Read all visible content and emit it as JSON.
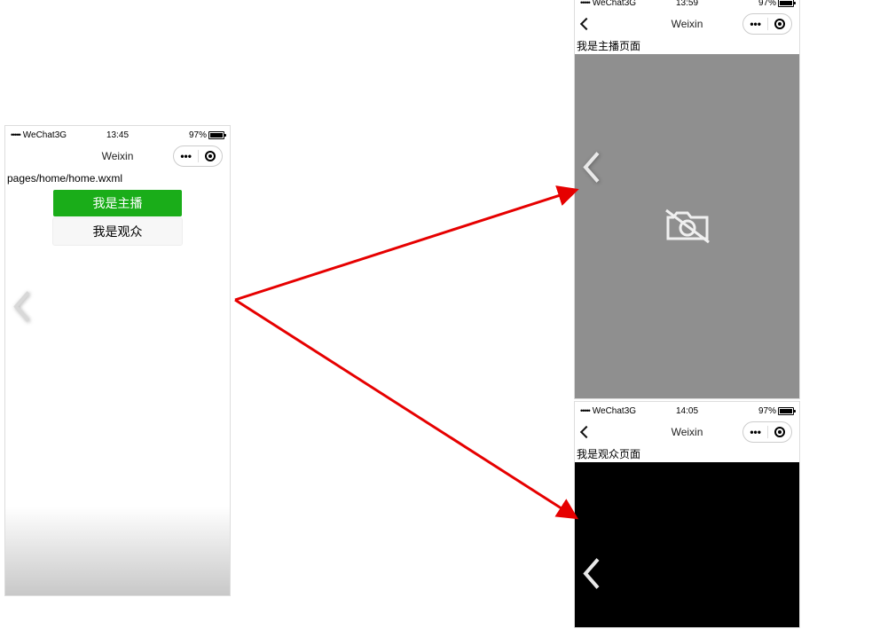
{
  "left": {
    "status": {
      "carrier": "WeChat3G",
      "time": "13:45",
      "battery": "97%"
    },
    "title": "Weixin",
    "path": "pages/home/home.wxml",
    "btn_host": "我是主播",
    "btn_viewer": "我是观众"
  },
  "right_top": {
    "status": {
      "carrier": "WeChat3G",
      "time": "13:59",
      "battery": "97%"
    },
    "title": "Weixin",
    "page_label": "我是主播页面"
  },
  "right_bottom": {
    "status": {
      "carrier": "WeChat3G",
      "time": "14:05",
      "battery": "97%"
    },
    "title": "Weixin",
    "page_label": "我是观众页面"
  },
  "glyphs": {
    "dots": "•••••",
    "capsule_dots": "•••"
  }
}
